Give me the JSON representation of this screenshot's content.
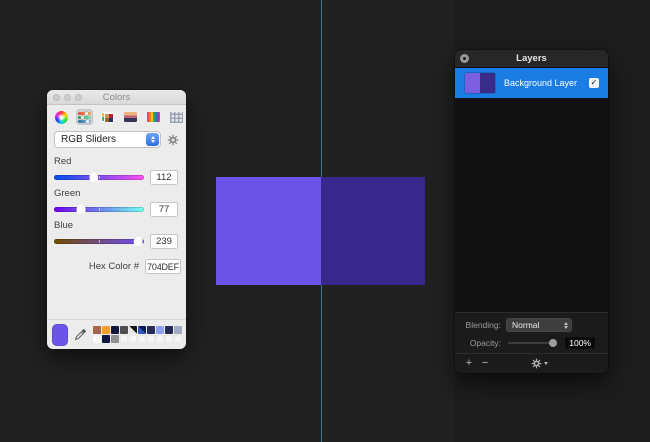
{
  "desktop": {
    "bg": "#212121",
    "right_band": "#1d1d1d",
    "guide_color": "#44708f"
  },
  "canvas_rect": {
    "left_color": "#6C54E8",
    "right_color": "#38288C"
  },
  "icons": {
    "layer_visible_check": "✓"
  },
  "colors_panel": {
    "title": "Colors",
    "toolbar_icons": [
      "color-wheel",
      "sliders",
      "color-palettes",
      "image-palettes",
      "pencils",
      "pattern"
    ],
    "selected_tool": "sliders",
    "mode_dropdown": {
      "value": "RGB Sliders"
    },
    "sliders": [
      {
        "label": "Red",
        "value": "112",
        "max": 255,
        "track_from": "#004DEF",
        "track_to": "#FF4DEF"
      },
      {
        "label": "Green",
        "value": "77",
        "max": 255,
        "track_from": "#7000EF",
        "track_to": "#70FFEF"
      },
      {
        "label": "Blue",
        "value": "239",
        "max": 255,
        "track_from": "#704D00",
        "track_to": "#704DFF"
      }
    ],
    "hex": {
      "label": "Hex Color #",
      "value": "704DEF"
    },
    "current_color": "#6C54E8",
    "swatches": {
      "row1": [
        "#a8673f",
        "#f69d2d",
        "#10173c",
        "#4f4f4f",
        "diag45:#e8e8e8:#151515",
        "diag45:#2e55c0:#101a4a",
        "#262c55",
        "#8e9ff0",
        "#232a52",
        "#a3aac4"
      ],
      "row2": [
        "#fafafa",
        "#0e1540",
        "#909090",
        "",
        "",
        "",
        "",
        "",
        "",
        ""
      ]
    }
  },
  "layers_panel": {
    "title": "Layers",
    "layers": [
      {
        "name": "Background Layer",
        "selected": true,
        "visible": true,
        "thumb_left": "#7a5fe0",
        "thumb_right": "#3a2c86"
      }
    ],
    "blending": {
      "label": "Blending:",
      "value": "Normal"
    },
    "opacity": {
      "label": "Opacity:",
      "value": "100%",
      "pct": 100
    },
    "footer_buttons": {
      "add": "+",
      "remove": "−"
    }
  }
}
